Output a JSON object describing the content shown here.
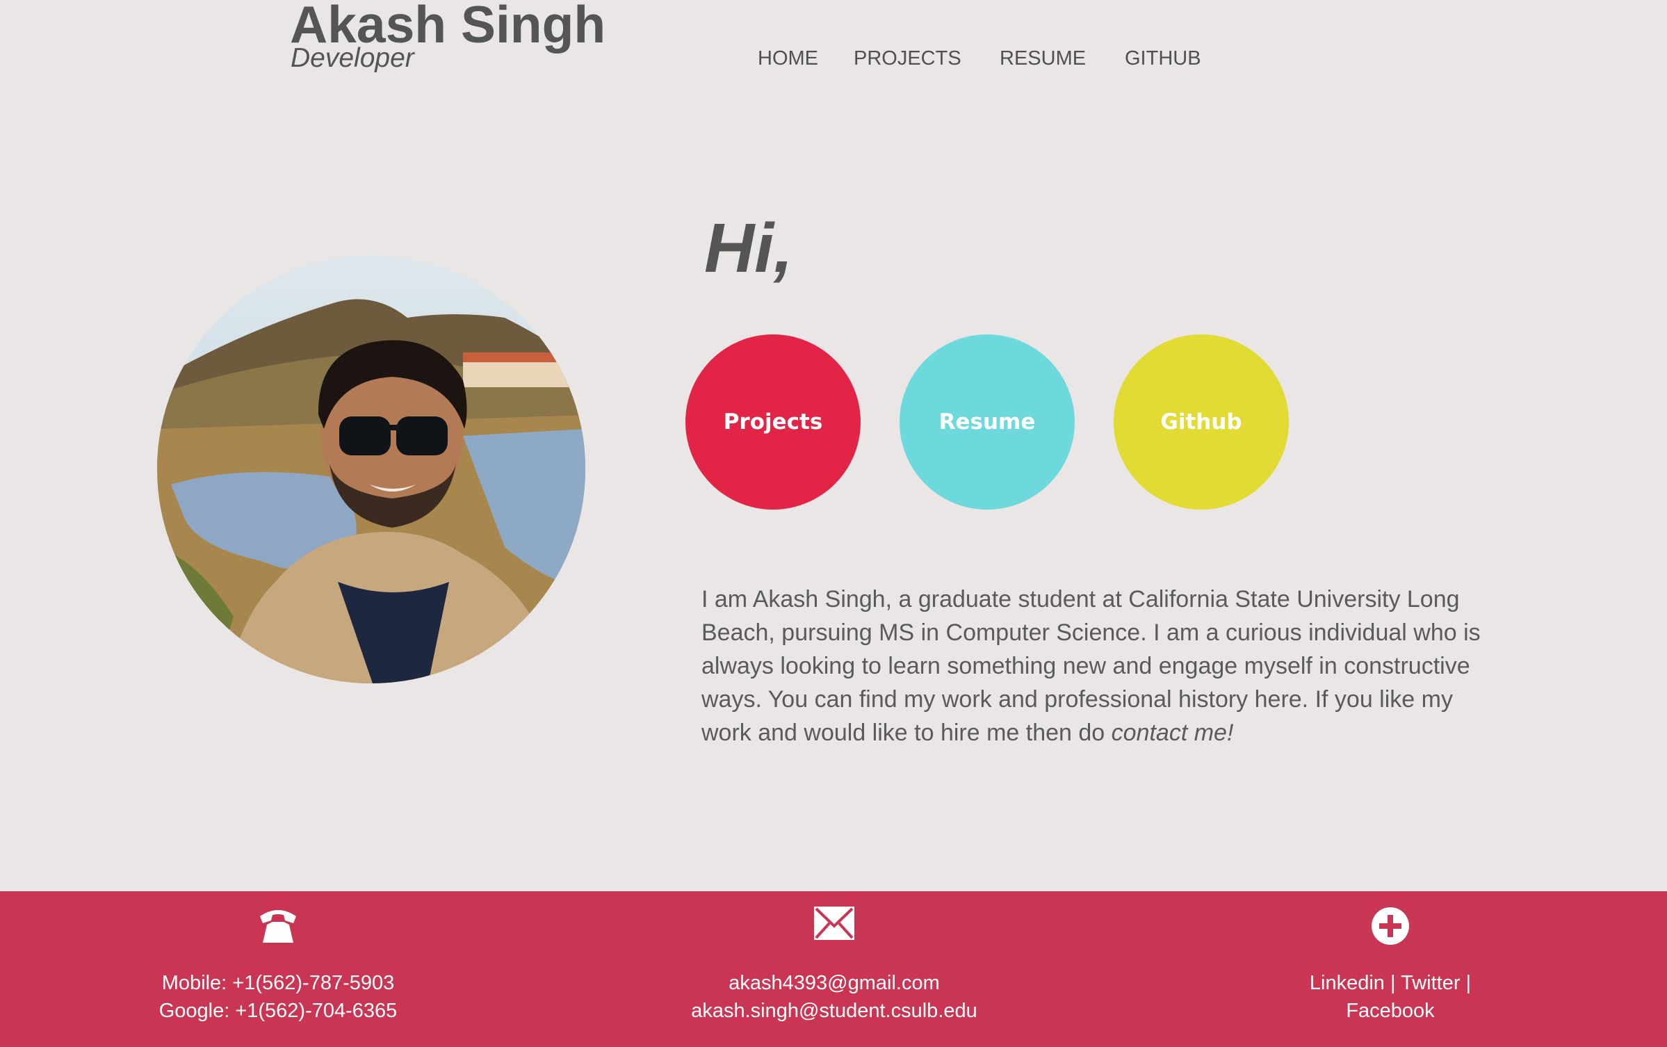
{
  "header": {
    "name": "Akash Singh",
    "tagline": "Developer"
  },
  "nav": {
    "items": [
      {
        "label": "HOME"
      },
      {
        "label": "PROJECTS"
      },
      {
        "label": "RESUME"
      },
      {
        "label": "GITHUB"
      }
    ]
  },
  "hero": {
    "greeting": "Hi,",
    "buttons": [
      {
        "label": "Projects",
        "color": "#e22546"
      },
      {
        "label": "Resume",
        "color": "#6ed9dd"
      },
      {
        "label": "Github",
        "color": "#e2db33"
      }
    ]
  },
  "bio": {
    "text": "I am Akash Singh, a graduate student at California State University Long Beach, pursuing MS in Computer Science. I am a curious individual who is always looking to learn something new and engage myself in constructive ways. You can find my work and professional history here. If you like my work and would like to hire me then do ",
    "cta": "contact me!"
  },
  "footer": {
    "background": "#c93553",
    "phone": {
      "icon": "phone-icon",
      "mobile": "Mobile: +1(562)-787-5903",
      "google": "Google: +1(562)-704-6365"
    },
    "email": {
      "icon": "envelope-icon",
      "primary": "akash4393@gmail.com",
      "student": "akash.singh@student.csulb.edu"
    },
    "social": {
      "icon": "plus-circle-icon",
      "linkedin": "Linkedin",
      "twitter": "Twitter",
      "facebook": "Facebook",
      "separator": "|"
    }
  }
}
